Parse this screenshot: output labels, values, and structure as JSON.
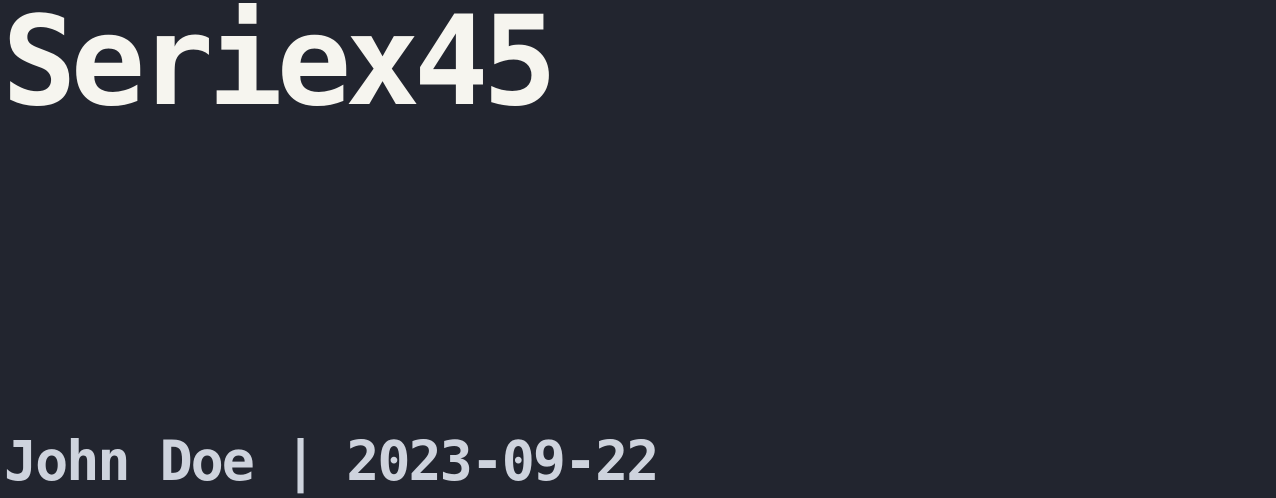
{
  "title": "Seriex45",
  "meta": "John Doe | 2023-09-22",
  "colors": {
    "background": "#22252f",
    "title": "#f6f5ef",
    "meta": "#ced3dd"
  }
}
